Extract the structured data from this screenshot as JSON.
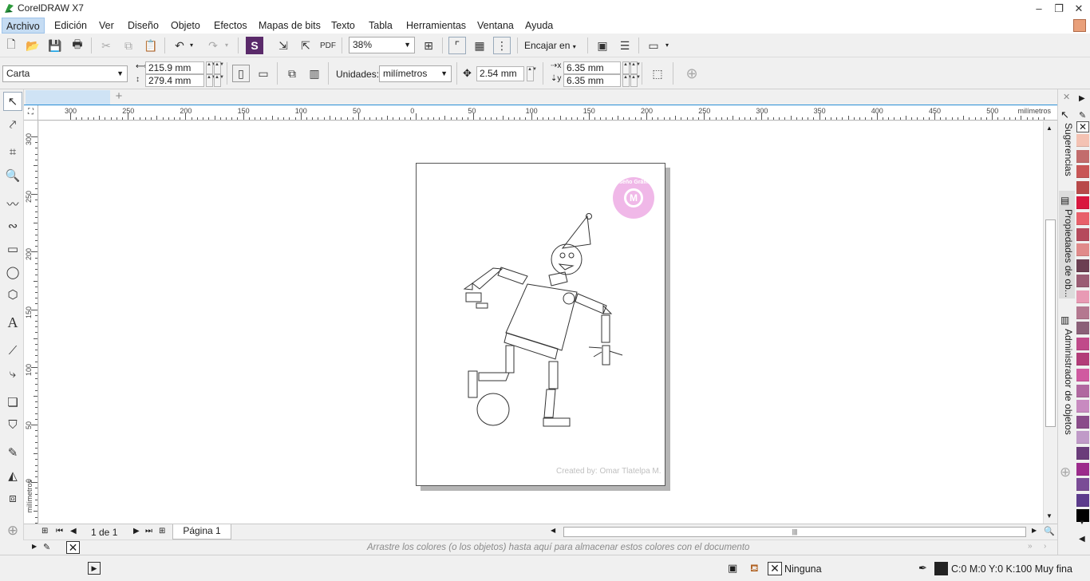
{
  "app": {
    "title": "CorelDRAW X7"
  },
  "menu": [
    {
      "label": "Archivo"
    },
    {
      "label": "Edición"
    },
    {
      "label": "Ver"
    },
    {
      "label": "Diseño"
    },
    {
      "label": "Objeto"
    },
    {
      "label": "Efectos"
    },
    {
      "label": "Mapas de bits"
    },
    {
      "label": "Texto"
    },
    {
      "label": "Tabla"
    },
    {
      "label": "Herramientas"
    },
    {
      "label": "Ventana"
    },
    {
      "label": "Ayuda"
    }
  ],
  "toolbar": {
    "zoom": "38%",
    "snap_label": "Encajar en"
  },
  "properties": {
    "paper_size": "Carta",
    "width": "215.9 mm",
    "height": "279.4 mm",
    "units_label": "Unidades:",
    "units": "milímetros",
    "nudge": "2.54 mm",
    "dup_x": "6.35 mm",
    "dup_y": "6.35 mm"
  },
  "ruler": {
    "h_ticks": [
      "300",
      "250",
      "200",
      "150",
      "100",
      "50",
      "0",
      "50",
      "100",
      "150",
      "200",
      "250",
      "300",
      "350",
      "400",
      "450",
      "500"
    ],
    "h_unit": "milímetros",
    "v_ticks": [
      "300",
      "250",
      "200",
      "150",
      "100",
      "50",
      "0"
    ],
    "v_unit": "milímetros"
  },
  "page": {
    "watermark": "Created by: Omar Tlatelpa M.",
    "logo_text": "Diseño Gráfico"
  },
  "nav": {
    "page_counter": "1 de 1",
    "page_tab": "Página 1"
  },
  "docpalette": {
    "hint": "Arrastre los colores (o los objetos) hasta aquí para almacenar estos colores con el documento"
  },
  "status": {
    "fill_label": "Ninguna",
    "outline_label": "C:0 M:0 Y:0 K:100 Muy fina"
  },
  "dockers": [
    {
      "label": "Sugerencias"
    },
    {
      "label": "Propiedades de ob..."
    },
    {
      "label": "Administrador de objetos"
    }
  ],
  "palette": [
    "#f4c2b3",
    "#c26c6c",
    "#c85656",
    "#b84a4a",
    "#d9183f",
    "#e8606a",
    "#b54a5c",
    "#e08a8a",
    "#6b3f52",
    "#9a5c74",
    "#e89ab4",
    "#b47890",
    "#8a6078",
    "#c04a8a",
    "#b23c78",
    "#d05aa0",
    "#b068a0",
    "#c88ac0",
    "#8a4c8a",
    "#c09ac8",
    "#6a3c7a",
    "#9c2c8c",
    "#7a4c96",
    "#5c3c8c",
    "#000000"
  ]
}
